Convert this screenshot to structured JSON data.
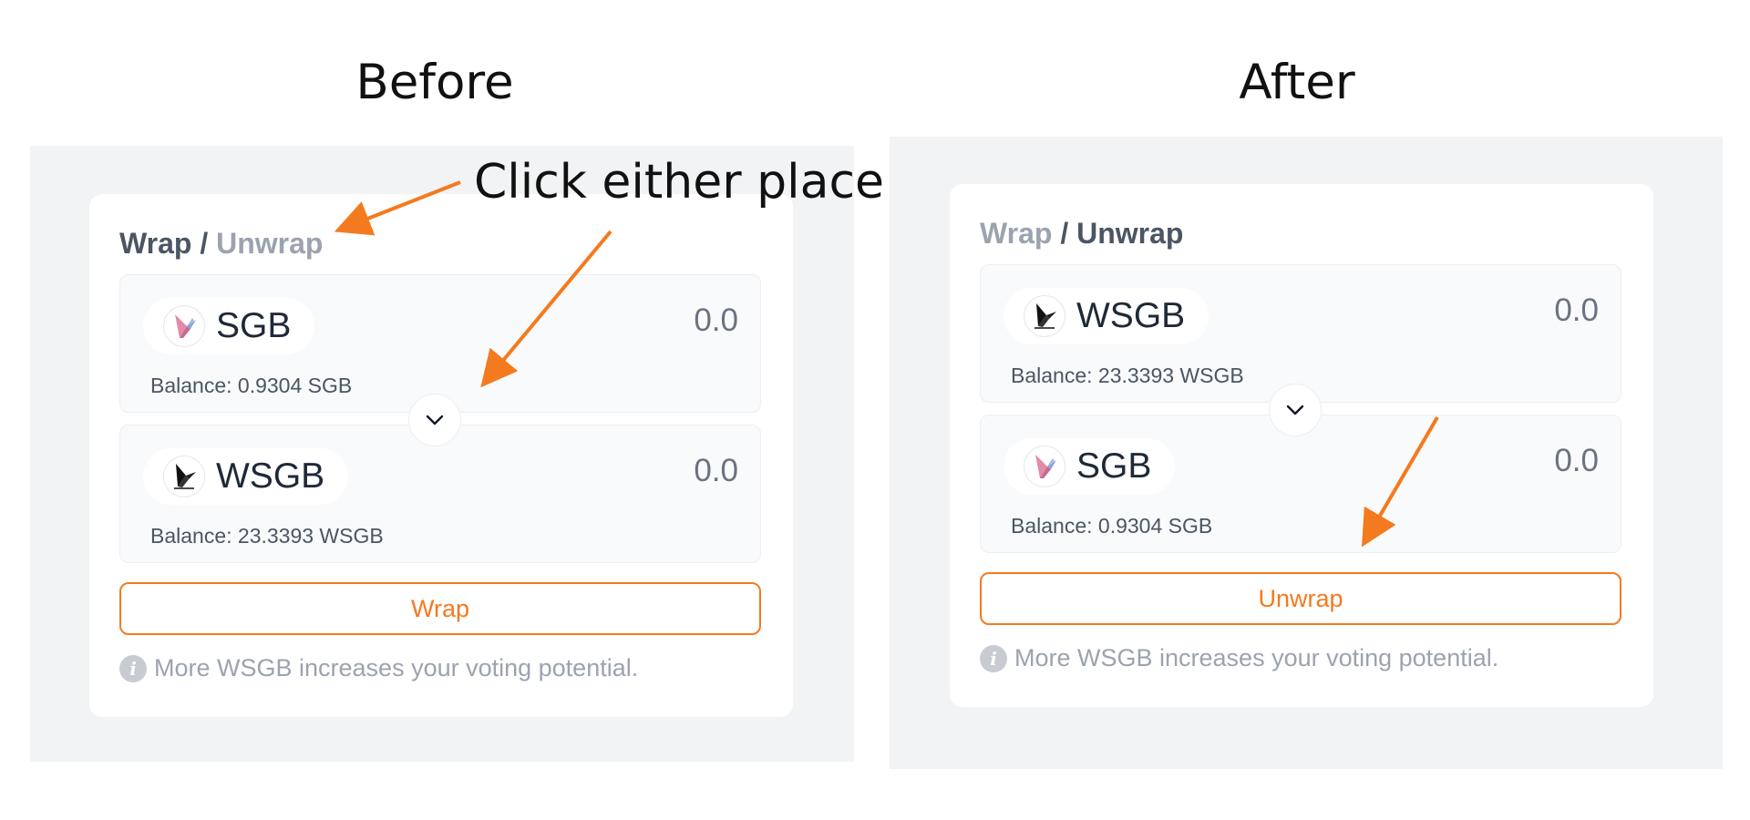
{
  "headings": {
    "before": "Before",
    "after": "After"
  },
  "callout": "Click either place",
  "colors": {
    "accent": "#f47a1f",
    "panel_bg": "#f2f3f5",
    "muted": "#9ca3af",
    "text": "#4b5563"
  },
  "before": {
    "tab_wrap": "Wrap",
    "tab_separator": "/",
    "tab_unwrap": "Unwrap",
    "active_tab": "Wrap",
    "from": {
      "symbol": "SGB",
      "icon": "sgb-bird-icon",
      "amount": "0.0",
      "balance": "Balance: 0.9304 SGB"
    },
    "to": {
      "symbol": "WSGB",
      "icon": "wsgb-bird-icon",
      "amount": "0.0",
      "balance": "Balance: 23.3393 WSGB"
    },
    "swap_icon": "chevron-down-icon",
    "action_label": "Wrap",
    "info_icon": "info-icon",
    "info_text": "More WSGB increases your voting potential."
  },
  "after": {
    "tab_wrap": "Wrap",
    "tab_separator": "/",
    "tab_unwrap": "Unwrap",
    "active_tab": "Unwrap",
    "from": {
      "symbol": "WSGB",
      "icon": "wsgb-bird-icon",
      "amount": "0.0",
      "balance": "Balance: 23.3393 WSGB"
    },
    "to": {
      "symbol": "SGB",
      "icon": "sgb-bird-icon",
      "amount": "0.0",
      "balance": "Balance: 0.9304 SGB"
    },
    "swap_icon": "chevron-down-icon",
    "action_label": "Unwrap",
    "info_icon": "info-icon",
    "info_text": "More WSGB increases your voting potential."
  }
}
